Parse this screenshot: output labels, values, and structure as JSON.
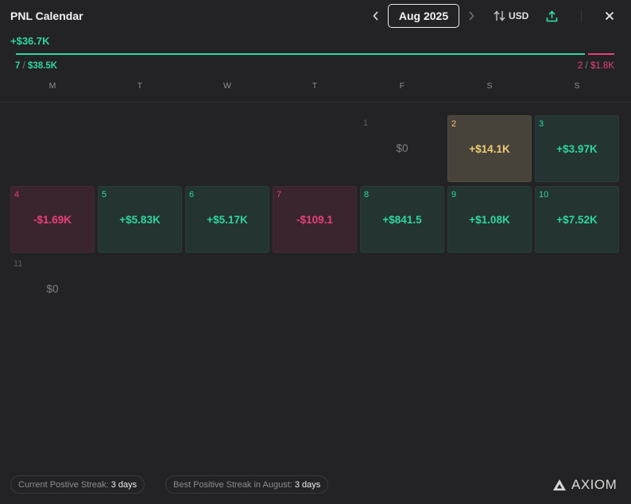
{
  "header": {
    "title": "PNL Calendar",
    "month_label": "Aug 2025",
    "currency_label": "USD"
  },
  "summary": {
    "total_pnl": "+$36.7K",
    "positive_days": "7",
    "positive_total": "$38.5K",
    "negative_days": "2",
    "negative_total": "$1.8K",
    "positive_fraction": 0.955
  },
  "weekdays": [
    "M",
    "T",
    "W",
    "T",
    "F",
    "S",
    "S"
  ],
  "days": [
    {
      "day": "1",
      "value": "$0",
      "status": "empty"
    },
    {
      "day": "2",
      "value": "+$14.1K",
      "status": "best"
    },
    {
      "day": "3",
      "value": "+$3.97K",
      "status": "positive"
    },
    {
      "day": "4",
      "value": "-$1.69K",
      "status": "negative"
    },
    {
      "day": "5",
      "value": "+$5.83K",
      "status": "positive"
    },
    {
      "day": "6",
      "value": "+$5.17K",
      "status": "positive"
    },
    {
      "day": "7",
      "value": "-$109.1",
      "status": "negative"
    },
    {
      "day": "8",
      "value": "+$841.5",
      "status": "positive"
    },
    {
      "day": "9",
      "value": "+$1.08K",
      "status": "positive"
    },
    {
      "day": "10",
      "value": "+$7.52K",
      "status": "positive"
    },
    {
      "day": "11",
      "value": "$0",
      "status": "empty"
    }
  ],
  "footer": {
    "current_streak_label": "Current Postive Streak:",
    "current_streak_value": "3 days",
    "best_streak_label": "Best Positive Streak in August:",
    "best_streak_value": "3 days",
    "brand": "AXIOM"
  },
  "colors": {
    "positive": "#2fd5a2",
    "negative": "#e8407a",
    "best": "#eeca76",
    "background": "#232325"
  },
  "icons": {
    "prev": "chevron-left-icon",
    "next": "chevron-right-icon",
    "currency": "swap-vertical-icon",
    "share": "upload-share-icon",
    "close": "close-icon",
    "logo": "axiom-logo-icon"
  }
}
